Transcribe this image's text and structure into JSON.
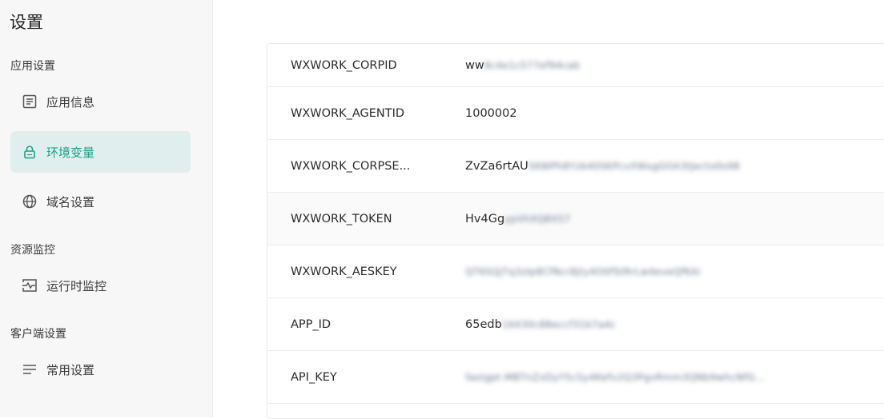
{
  "sidebar": {
    "title": "设置",
    "groups": [
      {
        "label": "应用设置"
      },
      {
        "label": "资源监控"
      },
      {
        "label": "客户端设置"
      }
    ],
    "items": [
      {
        "label": "应用信息",
        "icon": "document-icon"
      },
      {
        "label": "环境变量",
        "icon": "lock-icon",
        "active": true
      },
      {
        "label": "域名设置",
        "icon": "globe-icon"
      },
      {
        "label": "运行时监控",
        "icon": "monitor-icon"
      },
      {
        "label": "常用设置",
        "icon": "menu-lines-icon"
      }
    ],
    "accent_color": "#19a184",
    "active_bg": "#e0efee"
  },
  "env_table": {
    "rows": [
      {
        "key": "WXWORK_CORPID",
        "value_visible": "ww",
        "value_blurred": "8c4e1c577ef94cab"
      },
      {
        "key": "WXWORK_AGENTID",
        "value_visible": "1000002",
        "value_blurred": ""
      },
      {
        "key": "WXWORK_CORPSE...",
        "value_visible": "ZvZa6rtAU",
        "value_blurred": "5KWPh8Yzb40SKPcvXWsgGOA3tJecto0s98"
      },
      {
        "key": "WXWORK_TOKEN",
        "value_visible": "Hv4Gg",
        "value_blurred": "ypVhXQ8X57"
      },
      {
        "key": "WXWORK_AESKEY",
        "value_visible": "",
        "value_blurred": "QT6SQjTq3zIp8CfNcr8jty4O0fStRrLw4eveQfKAi"
      },
      {
        "key": "APP_ID",
        "value_visible": "65edb",
        "value_blurred": "16430c88eccf31b7a4c"
      },
      {
        "key": "API_KEY",
        "value_visible": "",
        "value_blurred": "fastgpt-MBTnZxDyY5c5y4Kefv2Q3PgvRmm3QNb9whcNfG..."
      }
    ]
  }
}
